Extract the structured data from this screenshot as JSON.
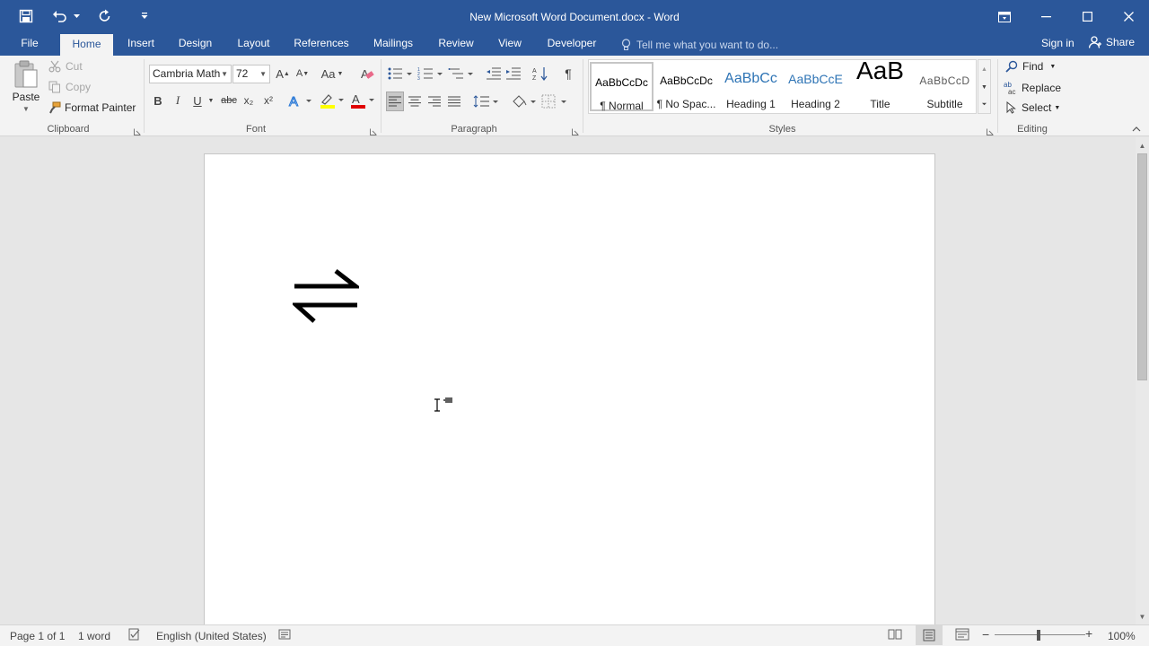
{
  "window": {
    "title": "New Microsoft Word Document.docx - Word"
  },
  "qat": {
    "icons": [
      "save-icon",
      "undo-icon",
      "dropdown-icon",
      "repeat-icon",
      "customize-icon"
    ]
  },
  "tabs": [
    "File",
    "Home",
    "Insert",
    "Design",
    "Layout",
    "References",
    "Mailings",
    "Review",
    "View",
    "Developer"
  ],
  "active_tab": "Home",
  "tell_me": "Tell me what you want to do...",
  "account": {
    "signin": "Sign in",
    "share": "Share"
  },
  "clipboard": {
    "paste": "Paste",
    "cut": "Cut",
    "copy": "Copy",
    "format_painter": "Format Painter",
    "label": "Clipboard"
  },
  "font": {
    "name": "Cambria Math",
    "size": "72",
    "label": "Font",
    "buttons": [
      "B",
      "I",
      "U",
      "abc",
      "x₂",
      "x²"
    ],
    "highlight_color": "#ffff00",
    "font_color": "#e00000"
  },
  "paragraph": {
    "label": "Paragraph"
  },
  "styles": {
    "label": "Styles",
    "items": [
      {
        "sample": "AaBbCcDc",
        "name": "¶ Normal"
      },
      {
        "sample": "AaBbCcDc",
        "name": "¶ No Spac..."
      },
      {
        "sample": "AaBbCc",
        "name": "Heading 1"
      },
      {
        "sample": "AaBbCcE",
        "name": "Heading 2"
      },
      {
        "sample": "AaB",
        "name": "Title"
      },
      {
        "sample": "AaBbCcD",
        "name": "Subtitle"
      }
    ]
  },
  "editing": {
    "find": "Find",
    "replace": "Replace",
    "select": "Select",
    "label": "Editing"
  },
  "document": {
    "content_symbol": "⇌"
  },
  "status": {
    "page": "Page 1 of 1",
    "words": "1 word",
    "language": "English (United States)",
    "zoom": "100%"
  },
  "colors": {
    "accent": "#2b579a",
    "ribbon": "#f3f3f3",
    "canvas": "#e6e6e6"
  }
}
